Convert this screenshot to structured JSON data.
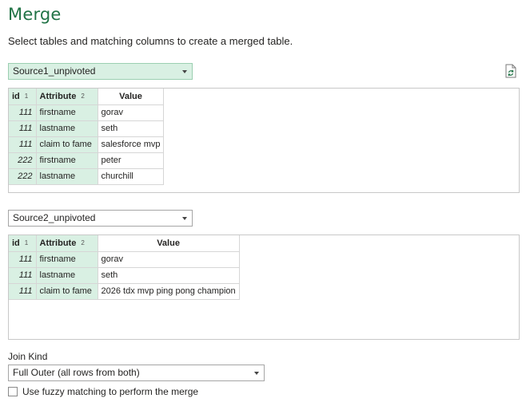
{
  "header": {
    "title": "Merge",
    "subtitle": "Select tables and matching columns to create a merged table."
  },
  "colors": {
    "accent": "#217346",
    "selection": "#d9f0e3"
  },
  "table1": {
    "source": "Source1_unpivoted",
    "columns": [
      {
        "label": "id",
        "order": "1"
      },
      {
        "label": "Attribute",
        "order": "2"
      },
      {
        "label": "Value",
        "order": ""
      }
    ],
    "rows": [
      [
        "111",
        "firstname",
        "gorav"
      ],
      [
        "111",
        "lastname",
        "seth"
      ],
      [
        "111",
        "claim to fame",
        "salesforce mvp"
      ],
      [
        "222",
        "firstname",
        "peter"
      ],
      [
        "222",
        "lastname",
        "churchill"
      ]
    ]
  },
  "table2": {
    "source": "Source2_unpivoted",
    "columns": [
      {
        "label": "id",
        "order": "1"
      },
      {
        "label": "Attribute",
        "order": "2"
      },
      {
        "label": "Value",
        "order": ""
      }
    ],
    "rows": [
      [
        "111",
        "firstname",
        "gorav"
      ],
      [
        "111",
        "lastname",
        "seth"
      ],
      [
        "111",
        "claim to fame",
        "2026 tdx mvp ping pong champion"
      ]
    ]
  },
  "join": {
    "label": "Join Kind",
    "selected": "Full Outer (all rows from both)"
  },
  "fuzzy": {
    "label": "Use fuzzy matching to perform the merge",
    "checked": false
  },
  "icons": {
    "refresh": "refresh-preview-icon",
    "caret": "chevron-down-icon"
  }
}
